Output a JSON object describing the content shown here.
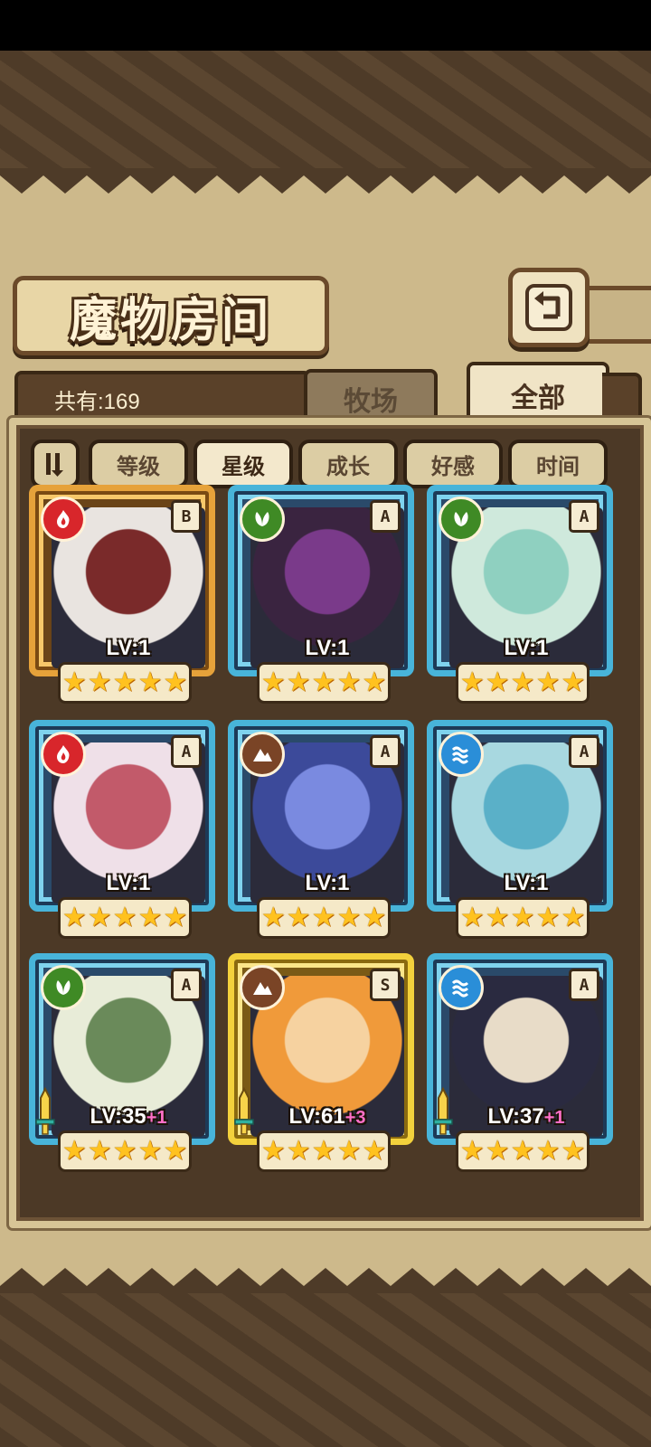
{
  "header": {
    "title": "魔物房间",
    "back_icon": "return-arrow-icon"
  },
  "summary": {
    "count_text": "共有:169"
  },
  "tabs": [
    {
      "label": "牧场",
      "active": false
    },
    {
      "label": "全部",
      "active": true
    }
  ],
  "sort": {
    "toggle_icon": "sort-order-icon",
    "buttons": [
      {
        "label": "等级",
        "active": false
      },
      {
        "label": "星级",
        "active": true
      },
      {
        "label": "成长",
        "active": false
      },
      {
        "label": "好感",
        "active": false
      },
      {
        "label": "时间",
        "active": false
      }
    ]
  },
  "element_colors": {
    "fire": "#d8262b",
    "nature": "#3f8a25",
    "earth": "#7a4426",
    "water": "#2a8ed8"
  },
  "monsters": [
    {
      "level": "LV:1",
      "plus": "",
      "rank": "B",
      "element": "fire",
      "stars": 5,
      "frame": "gold",
      "equipped": false
    },
    {
      "level": "LV:1",
      "plus": "",
      "rank": "A",
      "element": "nature",
      "stars": 5,
      "frame": "blue",
      "equipped": false
    },
    {
      "level": "LV:1",
      "plus": "",
      "rank": "A",
      "element": "nature",
      "stars": 5,
      "frame": "blue",
      "equipped": false
    },
    {
      "level": "LV:1",
      "plus": "",
      "rank": "A",
      "element": "fire",
      "stars": 5,
      "frame": "blue",
      "equipped": false
    },
    {
      "level": "LV:1",
      "plus": "",
      "rank": "A",
      "element": "earth",
      "stars": 5,
      "frame": "blue",
      "equipped": false
    },
    {
      "level": "LV:1",
      "plus": "",
      "rank": "A",
      "element": "water",
      "stars": 5,
      "frame": "blue",
      "equipped": false
    },
    {
      "level": "LV:35",
      "plus": "+1",
      "rank": "A",
      "element": "nature",
      "stars": 5,
      "frame": "blue",
      "equipped": true
    },
    {
      "level": "LV:61",
      "plus": "+3",
      "rank": "S",
      "element": "earth",
      "stars": 5,
      "frame": "yellow",
      "equipped": true
    },
    {
      "level": "LV:37",
      "plus": "+1",
      "rank": "A",
      "element": "water",
      "stars": 5,
      "frame": "blue",
      "equipped": true
    }
  ]
}
